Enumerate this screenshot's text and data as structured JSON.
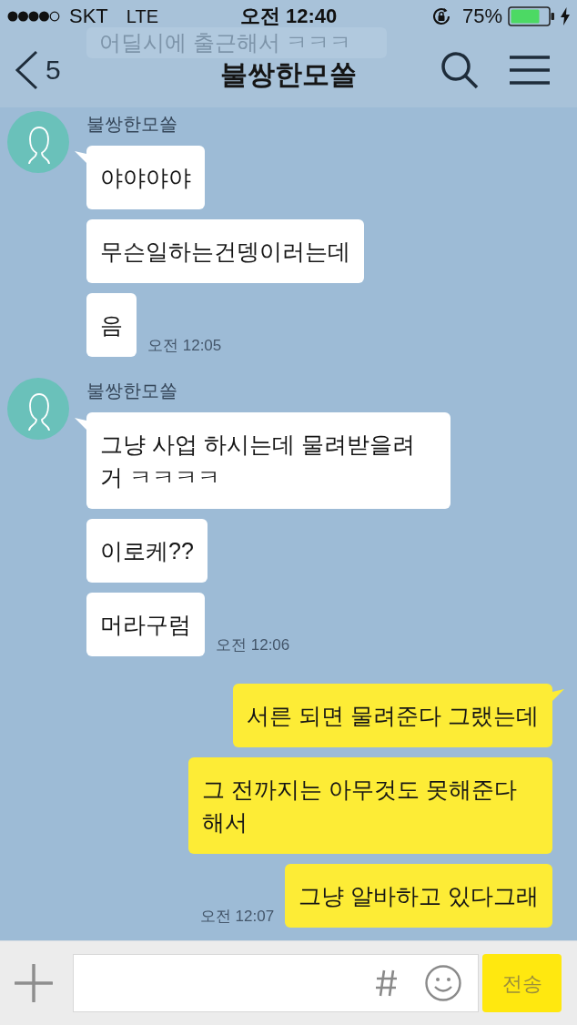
{
  "status_bar": {
    "carrier": "SKT",
    "network": "LTE",
    "time": "오전 12:40",
    "battery": "75%"
  },
  "header": {
    "back_count": "5",
    "title": "불쌍한모쏠",
    "faded_message": "어딜시에 출근해서 ㅋㅋㅋ"
  },
  "messages": [
    {
      "kind": "received",
      "sender": "불쌍한모쏠",
      "bubbles": [
        "야야야야",
        "무슨일하는건뎅이러는데",
        "음"
      ],
      "time": "오전 12:05"
    },
    {
      "kind": "received",
      "sender": "불쌍한모쏠",
      "bubbles": [
        "그냥 사업 하시는데 물려받을려 거 ㅋㅋㅋㅋ",
        "이로케??",
        "머라구럼"
      ],
      "time": "오전 12:06"
    },
    {
      "kind": "sent",
      "bubbles": [
        "서른 되면 물려준다 그랬는데",
        "그 전까지는 아무것도 못해준다 해서",
        "그냥 알바하고 있다그래"
      ],
      "time": "오전 12:07"
    }
  ],
  "composer": {
    "send_label": "전송",
    "send_disabled": true
  }
}
